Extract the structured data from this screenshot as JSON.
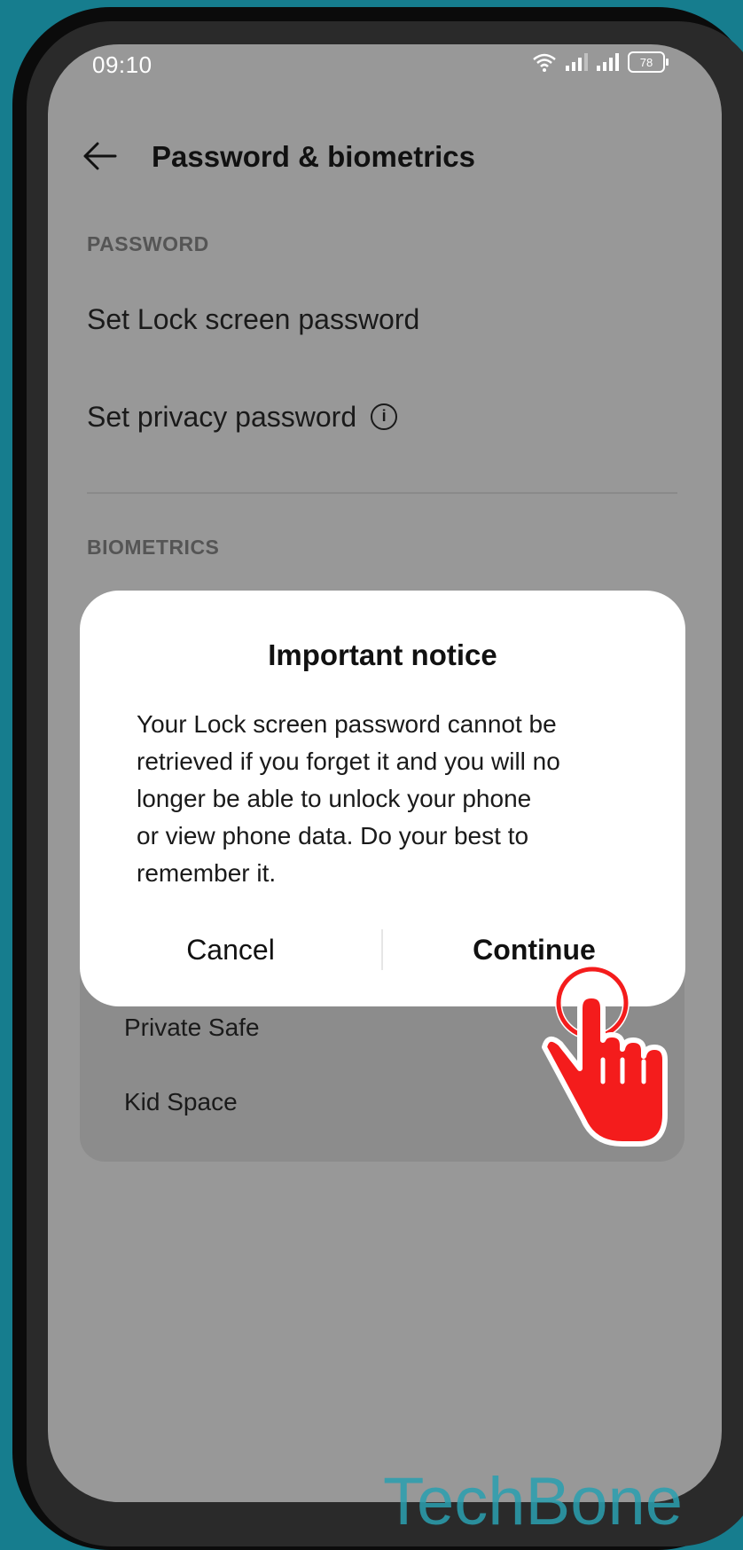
{
  "status_bar": {
    "time": "09:10",
    "battery": "78",
    "icons": [
      "wifi-icon",
      "signal-icon",
      "signal-icon",
      "battery-icon"
    ]
  },
  "header": {
    "title": "Password & biometrics",
    "back_icon": "arrow-left-icon"
  },
  "password_section": {
    "heading": "PASSWORD",
    "items": [
      "Set Lock screen password",
      "Set privacy password"
    ]
  },
  "biometrics_section": {
    "heading": "BIOMETRICS"
  },
  "card": {
    "items": [
      "Private Safe",
      "Kid Space"
    ]
  },
  "dialog": {
    "title": "Important notice",
    "lines": [
      "Your Lock screen password cannot be",
      "retrieved if you forget it and you will no",
      "longer be able to unlock your phone",
      "or view phone data. Do your best to",
      "remember it."
    ],
    "cancel_label": "Cancel",
    "continue_label": "Continue"
  },
  "overlay": {
    "hand_icon": "tap-hand-icon",
    "hand_color": "#f41c1c"
  },
  "watermark": "TechBone"
}
